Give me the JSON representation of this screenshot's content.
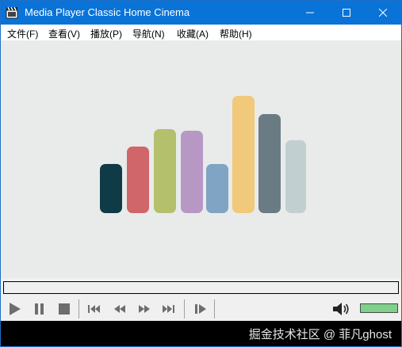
{
  "window": {
    "title": "Media Player Classic Home Cinema",
    "accent_color": "#0a73d8",
    "icons": {
      "app": "clapperboard-icon",
      "minimize": "minimize-icon",
      "maximize": "maximize-icon",
      "close": "close-icon"
    }
  },
  "menu": {
    "items": [
      {
        "label": "文件(F)"
      },
      {
        "label": "查看(V)"
      },
      {
        "label": "播放(P)"
      },
      {
        "label": "导航(N)"
      },
      {
        "label": "收藏(A)"
      },
      {
        "label": "帮助(H)"
      }
    ]
  },
  "video": {
    "background": "#e8ebea",
    "logo_bar_colors": [
      "#0e3b45",
      "#d0656a",
      "#b4c06c",
      "#b798c5",
      "#7fa4c4",
      "#f1c97a",
      "#6a7b84",
      "#c2cfd0"
    ]
  },
  "seekbar": {
    "position": 0
  },
  "controls": {
    "buttons": [
      "play-icon",
      "pause-icon",
      "stop-icon",
      "skip-previous-icon",
      "rewind-icon",
      "fast-forward-icon",
      "skip-next-icon",
      "frame-step-icon"
    ],
    "volume_icon": "speaker-icon",
    "volume_level": 1.0,
    "volume_color": "#7ed08a"
  },
  "status": {
    "watermark": "掘金技术社区 @ 菲凡ghost"
  }
}
